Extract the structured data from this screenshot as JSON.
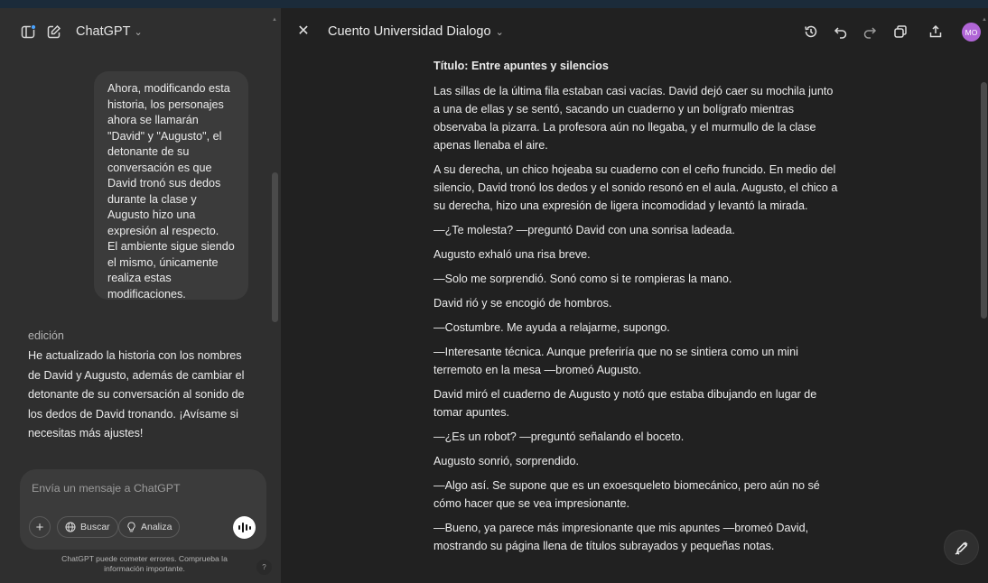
{
  "app": {
    "title": "ChatGPT"
  },
  "chat": {
    "user_message": [
      "Ahora, modificando esta historia, los personajes ahora se llamarán \"David\" y \"Augusto\", el detonante de su conversación es que David tronó sus dedos durante la clase y Augusto hizo una expresión al respecto.",
      "El ambiente sigue siendo el mismo, únicamente realiza estas modificaciones."
    ],
    "assistant_label": "edición",
    "assistant_message": "He actualizado la historia con los nombres de David y Augusto, además de cambiar el detonante de su conversación al sonido de los dedos de David tronando. ¡Avísame si necesitas más ajustes!"
  },
  "composer": {
    "placeholder": "Envía un mensaje a ChatGPT",
    "buscar_label": "Buscar",
    "analiza_label": "Analiza",
    "disclaimer": "ChatGPT puede cometer errores. Comprueba la información importante.",
    "help_label": "?"
  },
  "canvas": {
    "doc_title": "Cuento Universidad Dialogo",
    "avatar_initials": "MO",
    "heading": "Título: Entre apuntes y silencios",
    "paragraphs": [
      "Las sillas de la última fila estaban casi vacías. David dejó caer su mochila junto a una de ellas y se sentó, sacando un cuaderno y un bolígrafo mientras observaba la pizarra. La profesora aún no llegaba, y el murmullo de la clase apenas llenaba el aire.",
      "A su derecha, un chico hojeaba su cuaderno con el ceño fruncido. En medio del silencio, David tronó los dedos y el sonido resonó en el aula. Augusto, el chico a su derecha, hizo una expresión de ligera incomodidad y levantó la mirada.",
      "—¿Te molesta? —preguntó David con una sonrisa ladeada.",
      "Augusto exhaló una risa breve.",
      "—Solo me sorprendió. Sonó como si te rompieras la mano.",
      "David rió y se encogió de hombros.",
      "—Costumbre. Me ayuda a relajarme, supongo.",
      "—Interesante técnica. Aunque preferiría que no se sintiera como un mini terremoto en la mesa —bromeó Augusto.",
      "David miró el cuaderno de Augusto y notó que estaba dibujando en lugar de tomar apuntes.",
      "—¿Es un robot? —preguntó señalando el boceto.",
      "Augusto sonrió, sorprendido.",
      "—Algo así. Se supone que es un exoesqueleto biomecánico, pero aún no sé cómo hacer que se vea impresionante.",
      "—Bueno, ya parece más impresionante que mis apuntes —bromeó David, mostrando su página llena de títulos subrayados y pequeñas notas."
    ]
  },
  "icons": {
    "sidebar_toggle": "sidebar-toggle-icon",
    "new_chat": "new-chat-icon",
    "close": "close-icon",
    "history": "history-icon",
    "undo": "undo-icon",
    "redo": "redo-icon",
    "copy": "copy-icon",
    "share": "share-icon",
    "edit": "edit-pencil-icon"
  },
  "colors": {
    "avatar": "#b065d6",
    "sidebar_bg": "#2f2f2f",
    "canvas_bg": "#212121"
  }
}
